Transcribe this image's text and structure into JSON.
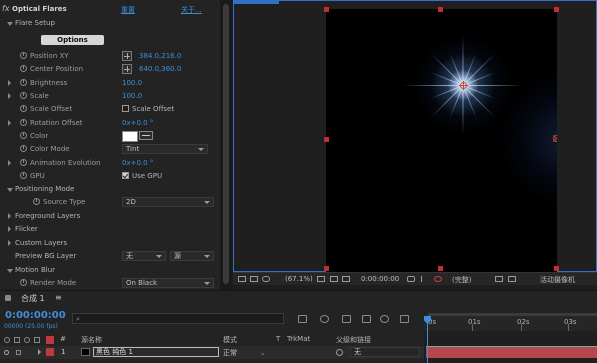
{
  "effect": {
    "fx_label": "fx",
    "name": "Optical Flares",
    "reset_label": "重置",
    "about_label": "关于..."
  },
  "props": {
    "flare_setup": "Flare Setup",
    "options": "Options",
    "position_xy": {
      "label": "Position XY",
      "value": "384.0,216.0"
    },
    "center_position": {
      "label": "Center Position",
      "value": "640.0,360.0"
    },
    "brightness": {
      "label": "Brightness",
      "value": "100.0"
    },
    "scale": {
      "label": "Scale",
      "value": "100.0"
    },
    "scale_offset": {
      "label": "Scale Offset",
      "checkbox_label": "Scale Offset",
      "checked": false
    },
    "rotation_offset": {
      "label": "Rotation Offset",
      "value": "0x+0.0 °"
    },
    "color": {
      "label": "Color",
      "swatch": "#ffffff"
    },
    "color_mode": {
      "label": "Color Mode",
      "value": "Tint"
    },
    "animation_evolution": {
      "label": "Animation Evolution",
      "value": "0x+0.0 °"
    },
    "gpu": {
      "label": "GPU",
      "checkbox_label": "Use GPU",
      "checked": true
    },
    "positioning_mode": "Positioning Mode",
    "source_type": {
      "label": "Source Type",
      "value": "2D"
    },
    "foreground_layers": "Foreground Layers",
    "flicker": "Flicker",
    "custom_layers": "Custom Layers",
    "preview_bg_layer": {
      "label": "Preview BG Layer",
      "value1": "无",
      "value2": "源"
    },
    "motion_blur": "Motion Blur",
    "render_mode": {
      "label": "Render Mode",
      "value": "On Black"
    }
  },
  "viewer": {
    "zoom": "(67.1%)",
    "timecode": "0:00:00:00",
    "quality": "(完整)",
    "camera": "活动摄像机"
  },
  "timeline": {
    "comp_tab": "合成 1",
    "timecode": "0:00:00:00",
    "fps": "00000 (25.00 fps)",
    "search_placeholder": "",
    "columns": {
      "num": "#",
      "source_name": "源名称",
      "mode": "模式",
      "t": "T",
      "trkmat": "TrkMat",
      "parent": "父级和链接"
    },
    "ruler_labels": [
      "0s",
      "01s",
      "02s",
      "03s"
    ],
    "layer": {
      "index": "1",
      "label_color": "#c0383e",
      "name": "黑色 纯色 1",
      "mode": "正常",
      "parent": "无"
    }
  },
  "colors": {
    "accent_blue": "#3d8fd9",
    "layer_bar": "#b8464d",
    "handle_red": "#c22d2d"
  }
}
